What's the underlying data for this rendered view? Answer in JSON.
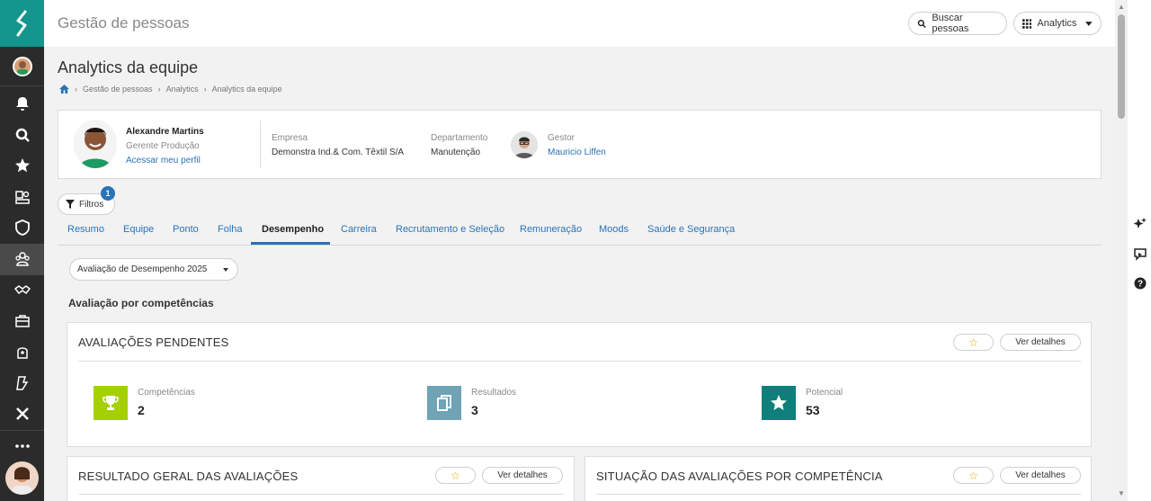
{
  "app": {
    "title": "Gestão de pessoas"
  },
  "header": {
    "search_label": "Buscar pessoas",
    "analytics_label": "Analytics"
  },
  "page": {
    "title": "Analytics da equipe",
    "breadcrumb": [
      "Gestão de pessoas",
      "Analytics",
      "Analytics da equipe"
    ]
  },
  "profile": {
    "name": "Alexandre Martins",
    "role": "Gerente Produção",
    "link": "Acessar meu perfil",
    "company_label": "Empresa",
    "company": "Demonstra Ind.& Com. Têxtil S/A",
    "department_label": "Departamento",
    "department": "Manutenção",
    "manager_label": "Gestor",
    "manager": "Mauricio Liffen"
  },
  "filters": {
    "label": "Filtros",
    "count": "1"
  },
  "tabs": [
    {
      "label": "Resumo"
    },
    {
      "label": "Equipe"
    },
    {
      "label": "Ponto"
    },
    {
      "label": "Folha"
    },
    {
      "label": "Desempenho",
      "active": true
    },
    {
      "label": "Carreira"
    },
    {
      "label": "Recrutamento e Seleção"
    },
    {
      "label": "Remuneração"
    },
    {
      "label": "Moods"
    },
    {
      "label": "Saúde e Segurança"
    }
  ],
  "select": {
    "value": "Avaliação de Desempenho 2025"
  },
  "section": {
    "title": "Avaliação por competências"
  },
  "cards": {
    "pending": {
      "title": "AVALIAÇÕES PENDENTES",
      "details_label": "Ver detalhes",
      "stats": [
        {
          "label": "Competências",
          "value": "2",
          "color": "#a4d000",
          "icon": "trophy-icon"
        },
        {
          "label": "Resultados",
          "value": "3",
          "color": "#6fa3b5",
          "icon": "copy-icon"
        },
        {
          "label": "Potencial",
          "value": "53",
          "color": "#0e7f7a",
          "icon": "star-icon"
        }
      ]
    },
    "overall": {
      "title": "RESULTADO GERAL DAS AVALIAÇÕES",
      "details_label": "Ver detalhes"
    },
    "status": {
      "title": "SITUAÇÃO DAS AVALIAÇÕES POR COMPETÊNCIA",
      "details_label": "Ver detalhes"
    }
  },
  "colors": {
    "brand": "#14958d",
    "link": "#2a73b8",
    "rail": "#2b2b2b"
  }
}
